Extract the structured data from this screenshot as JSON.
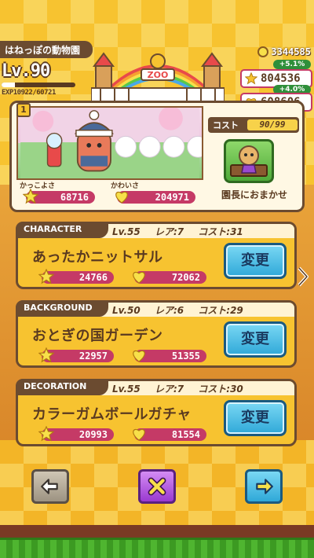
{
  "zoo": {
    "name": "はねっぽの動物園"
  },
  "player": {
    "level": "Lv.90",
    "exp_text": "EXP10922/60721",
    "exp_ratio": 0.18
  },
  "gate": {
    "sign": "ZOO"
  },
  "currency": {
    "coins": "3344585"
  },
  "stats": {
    "cool_bonus": "+5.1%",
    "cool_total": "804536",
    "cute_bonus": "+4.0%",
    "cute_total": "608606"
  },
  "slot": {
    "number": "1",
    "cool_label": "かっこよさ",
    "cool_value": "68716",
    "cute_label": "かわいさ",
    "cute_value": "204971"
  },
  "cost": {
    "label": "コスト",
    "value": "90/99"
  },
  "director": {
    "label": "園長におまかせ"
  },
  "items": [
    {
      "category": "CHARACTER",
      "level": "Lv.55",
      "rarity": "レア:7",
      "cost": "コスト:31",
      "name": "あったかニットサル",
      "cool": "24766",
      "cute": "72062",
      "button": "変更"
    },
    {
      "category": "BACKGROUND",
      "level": "Lv.50",
      "rarity": "レア:6",
      "cost": "コスト:29",
      "name": "おとぎの国ガーデン",
      "cool": "22957",
      "cute": "51355",
      "button": "変更"
    },
    {
      "category": "DECORATION",
      "level": "Lv.55",
      "rarity": "レア:7",
      "cost": "コスト:30",
      "name": "カラーガムボールガチャ",
      "cool": "20993",
      "cute": "81554",
      "button": "変更"
    }
  ],
  "icons": {
    "coin": "coin-icon",
    "star": "star-icon",
    "heart": "heart-icon",
    "back": "arrow-left-icon",
    "close": "close-icon",
    "next": "arrow-right-icon"
  },
  "colors": {
    "brown": "#6b4b30",
    "pink": "#c53a66",
    "gold": "#f7c330",
    "blue": "#2fa8d8"
  }
}
